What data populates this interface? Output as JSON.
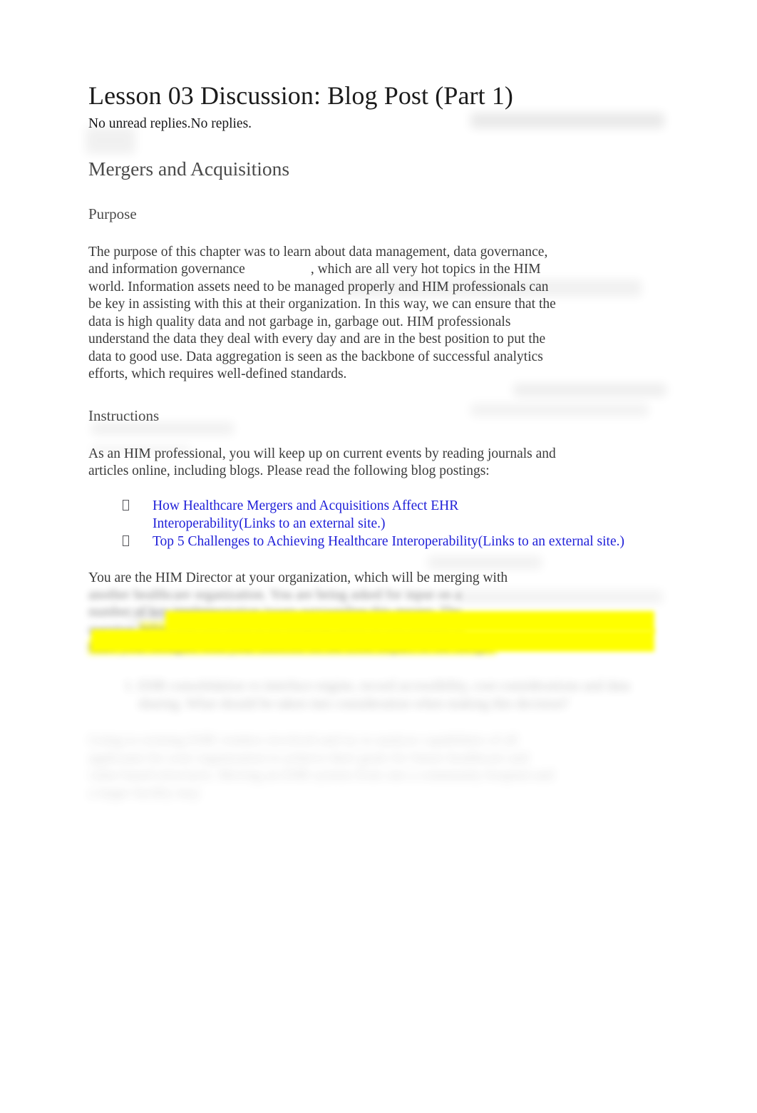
{
  "page": {
    "background_color": "#ffffff",
    "text_color": "#3b3b3b",
    "heading_color": "#4a4a4a",
    "link_color": "#2020d8",
    "highlight_color": "#ffff00"
  },
  "document": {
    "title": "Lesson 03 Discussion: Blog Post (Part 1)",
    "replies_status": "No unread replies.No replies.",
    "section_heading": "Mergers and Acquisitions"
  },
  "purpose": {
    "heading": "Purpose",
    "text_before_gap": "The purpose of this chapter was to learn about data management, data governance, and information governance",
    "text_after_gap": ", which are all very hot topics in the HIM world. Information assets need to be managed properly and HIM professionals can be key in assisting with this at their organization. In this way, we can ensure that the data is high quality data and not garbage in, garbage out. HIM professionals understand the data they deal with every day and are in the best position to put the data to good use. Data aggregation is seen as the backbone of successful analytics efforts, which requires well-defined standards."
  },
  "instructions": {
    "heading": "Instructions",
    "intro": "As an HIM professional, you will keep up on current events by reading journals and articles online, including blogs. Please read the following blog postings:",
    "links": [
      {
        "label": "How Healthcare Mergers and Acquisitions Affect EHR Interoperability",
        "external_note": "(Links to an external site.)"
      },
      {
        "label": "Top 5 Challenges to Achieving Healthcare Interoperability",
        "external_note": "(Links to an external site.)"
      }
    ]
  },
  "scenario": {
    "visible_line": "You are the HIM Director at your organization, which will be merging with",
    "obscured_line_1": "another healthcare organization. You are being asked for input on a",
    "obscured_line_2": "number of key implementation issues surrounding this merger. The",
    "obscured_line_3": "question ",
    "obscured_highlighted_1": "below that you need to be thinking about as you prepare to",
    "obscured_highlighted_2": "share your thoughts with your Director on the EHR impact of the merger."
  },
  "obscured_list": {
    "items": [
      "EHR consolidation vs interface engine, record accessibility, cost considerations and data sharing. What should be taken into consideration when making this decision?"
    ],
    "trailing_paragraph": "Going to existing EHR vendors involved and try to analyze capabilities of all applicants for your organization to achieve their goals for future healthcare and value based structures. Moving an EHR system from one a community hospital and a larger facility may"
  }
}
